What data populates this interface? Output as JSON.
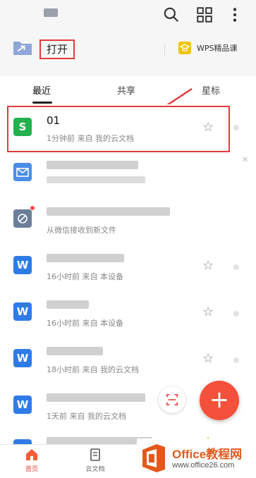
{
  "header": {
    "icons": [
      "search-icon",
      "grid-icon",
      "more-vertical-icon"
    ]
  },
  "actions": {
    "open_label": "打开",
    "wps_label": "WPS精品课"
  },
  "tabs": [
    {
      "label": "最近",
      "active": true
    },
    {
      "label": "共享",
      "active": false
    },
    {
      "label": "星标",
      "active": false
    }
  ],
  "files": [
    {
      "icon": "sheet-icon",
      "glyph": "S",
      "name": "01",
      "meta": "1分钟前    来自 我的云文档",
      "starred": false
    },
    {
      "icon": "mail-icon",
      "name": "",
      "meta": "",
      "starred": false
    },
    {
      "icon": "link-icon",
      "name": "",
      "meta": "从微信接收到新文件",
      "starred": false
    },
    {
      "icon": "word-icon",
      "glyph": "W",
      "name": "",
      "meta": "16小时前    来自 本设备",
      "starred": false
    },
    {
      "icon": "word-icon",
      "glyph": "W",
      "name": "",
      "meta": "16小时前    来自 本设备",
      "starred": false
    },
    {
      "icon": "word-icon",
      "glyph": "W",
      "name": "",
      "meta": "18小时前    来自 我的云文档",
      "starred": false
    },
    {
      "icon": "word-icon",
      "glyph": "W",
      "name": "",
      "meta": "1天前    来自 我的云文档",
      "starred": false
    },
    {
      "icon": "word-icon",
      "glyph": "W",
      "name": "",
      "meta": "",
      "starred": true
    }
  ],
  "bottom_nav": [
    {
      "label": "首页",
      "icon": "home-icon",
      "active": true
    },
    {
      "label": "云文档",
      "icon": "document-icon",
      "active": false
    }
  ],
  "watermark": {
    "title": "Office教程网",
    "url": "www.office26.com"
  },
  "colors": {
    "accent": "#f4503b",
    "highlight_border": "#e23b3b",
    "sheet": "#23b14d",
    "word": "#2f7be7"
  }
}
